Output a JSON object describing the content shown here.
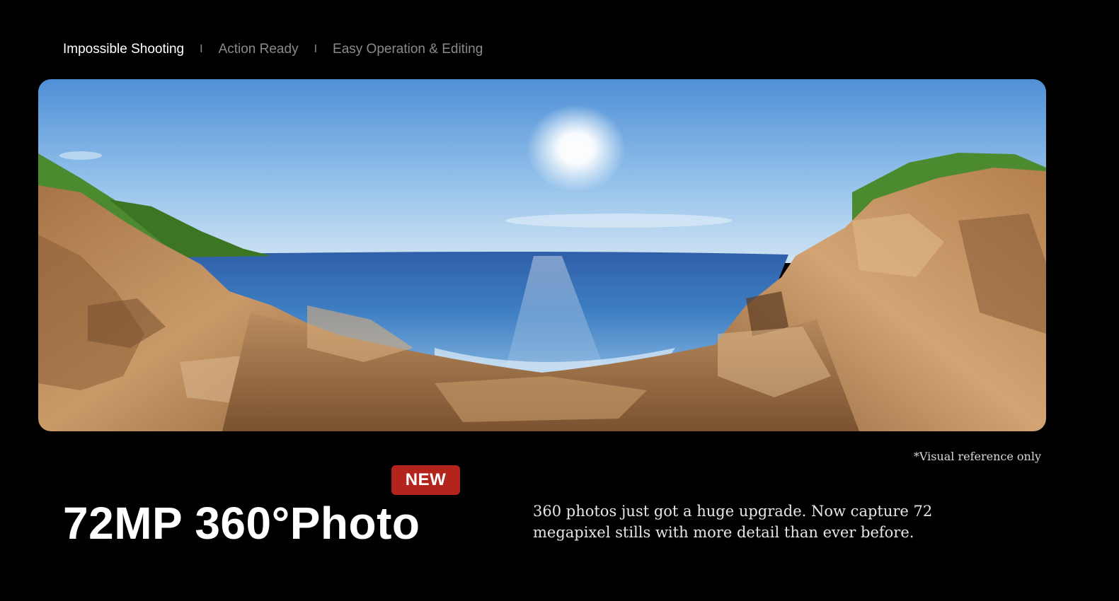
{
  "tabs": [
    {
      "label": "Impossible Shooting",
      "active": true
    },
    {
      "label": "Action Ready",
      "active": false
    },
    {
      "label": "Easy Operation & Editing",
      "active": false
    }
  ],
  "separator": "I",
  "photo": {
    "scene": "360 panorama of rocky seaside coast under sunny sky"
  },
  "disclaimer": "*Visual reference only",
  "badge": "NEW",
  "headline": "72MP 360°Photo",
  "description": "360 photos just got a huge upgrade. Now capture 72 megapixel stills with more detail than ever before.",
  "colors": {
    "background": "#000000",
    "badge": "#b3241c",
    "inactive_tab": "#8a8a8a"
  }
}
